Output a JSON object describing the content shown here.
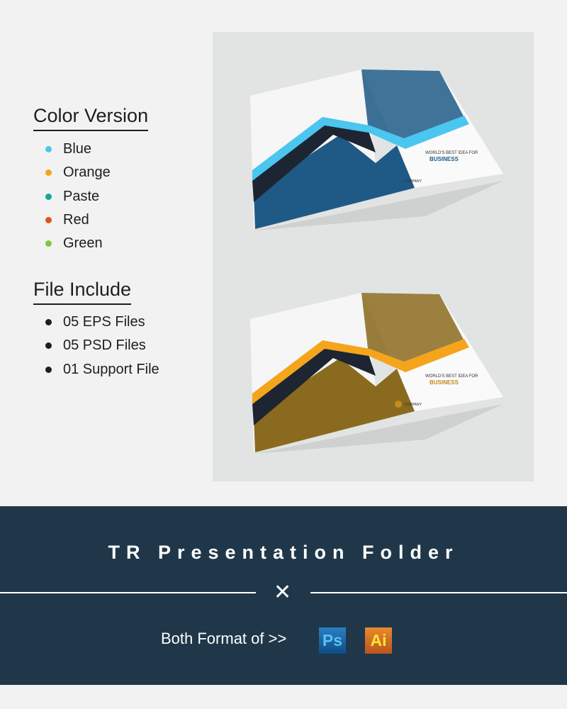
{
  "color_version": {
    "heading": "Color Version",
    "items": [
      {
        "label": "Blue",
        "color": "#4ac6ef"
      },
      {
        "label": "Orange",
        "color": "#f4a51c"
      },
      {
        "label": "Paste",
        "color": "#14a89a"
      },
      {
        "label": "Red",
        "color": "#e0541c"
      },
      {
        "label": "Green",
        "color": "#86c440"
      }
    ]
  },
  "file_include": {
    "heading": "File Include",
    "items": [
      "05 EPS Files",
      "05 PSD Files",
      "01 Support File"
    ]
  },
  "mockups": [
    {
      "accent": "#4ac6ef",
      "tagline": "WORLD'S BEST IDEA FOR",
      "headline": "BUSINESS",
      "company": "COMPANY"
    },
    {
      "accent": "#f4a51c",
      "tagline": "WORLD'S BEST IDEA FOR",
      "headline": "BUSINESS",
      "company": "COMPANY"
    }
  ],
  "footer": {
    "title": "TR Presentation Folder",
    "divider_icon": "close-x-icon",
    "format_text": "Both Format of >>",
    "badges": [
      {
        "label": "Ps",
        "icon": "photoshop-icon"
      },
      {
        "label": "Ai",
        "icon": "illustrator-icon"
      }
    ]
  }
}
